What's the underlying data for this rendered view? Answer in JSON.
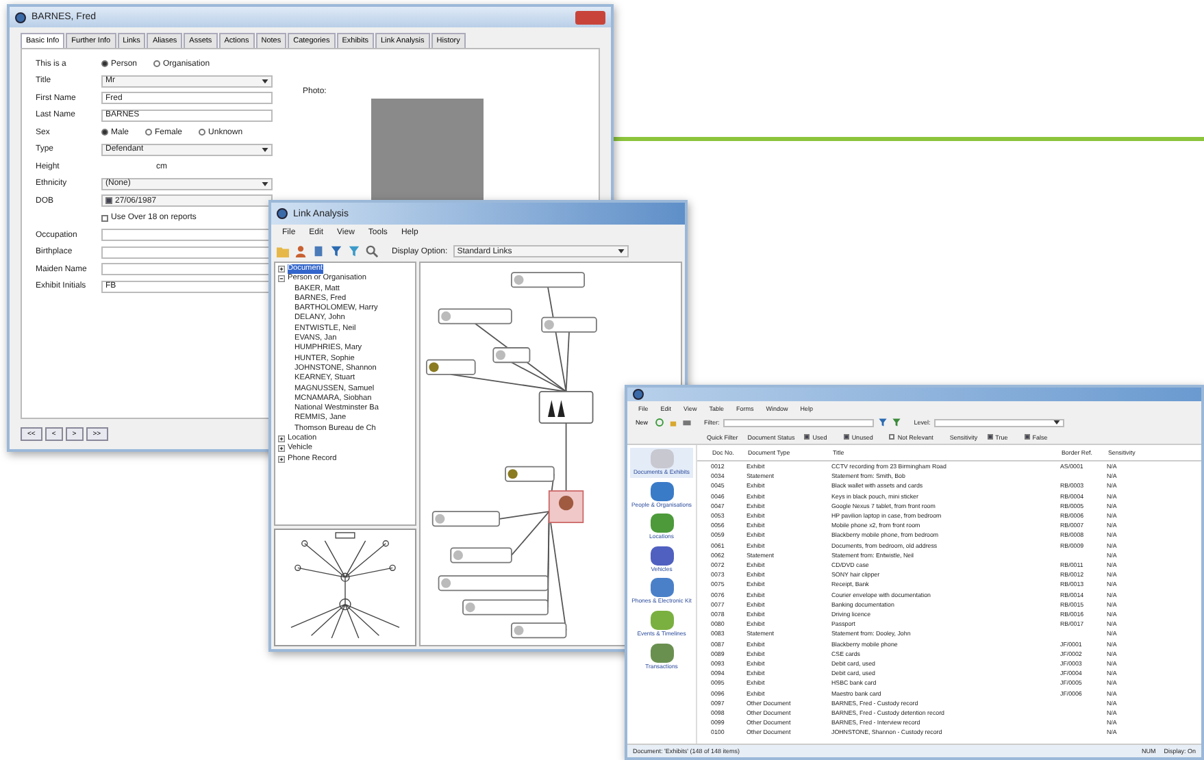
{
  "person_window": {
    "title": "BARNES, Fred",
    "tabs": [
      {
        "label": "Basic Info",
        "selected": true
      },
      {
        "label": "Further Info",
        "selected": false
      },
      {
        "label": "Links",
        "selected": false
      },
      {
        "label": "Aliases",
        "selected": false
      },
      {
        "label": "Assets",
        "selected": false
      },
      {
        "label": "Actions",
        "selected": false
      },
      {
        "label": "Notes",
        "selected": false
      },
      {
        "label": "Categories",
        "selected": false
      },
      {
        "label": "Exhibits",
        "selected": false
      },
      {
        "label": "Link Analysis",
        "selected": false
      },
      {
        "label": "History",
        "selected": false
      }
    ],
    "photo_label": "Photo:",
    "fields": [
      {
        "kind": "radio",
        "label": "This is a",
        "options": [
          {
            "label": "Person",
            "selected": true
          },
          {
            "label": "Organisation",
            "selected": false
          }
        ]
      },
      {
        "kind": "select",
        "label": "Title",
        "value": "Mr"
      },
      {
        "kind": "text",
        "label": "First Name",
        "value": "Fred"
      },
      {
        "kind": "text",
        "label": "Last Name",
        "value": "BARNES"
      },
      {
        "kind": "radio",
        "label": "Sex",
        "options": [
          {
            "label": "Male",
            "selected": true
          },
          {
            "label": "Female",
            "selected": false
          },
          {
            "label": "Unknown",
            "selected": false
          }
        ]
      },
      {
        "kind": "select",
        "label": "Type",
        "value": "Defendant"
      },
      {
        "kind": "unit",
        "label": "Height",
        "unit": "cm"
      },
      {
        "kind": "select",
        "label": "Ethnicity",
        "value": "(None)"
      },
      {
        "kind": "date",
        "label": "DOB",
        "value": "27/06/1987",
        "checked": true
      },
      {
        "kind": "check",
        "label": "Use Over 18 on reports",
        "checked": false
      },
      {
        "kind": "text",
        "label": "Occupation"
      },
      {
        "kind": "text",
        "label": "Birthplace"
      },
      {
        "kind": "text",
        "label": "Maiden Name"
      },
      {
        "kind": "text",
        "label": "Exhibit Initials",
        "value": "FB"
      }
    ],
    "nav_buttons": [
      "<<",
      "<",
      ">",
      ">>"
    ]
  },
  "link_window": {
    "title": "Link Analysis",
    "menu": [
      "File",
      "Edit",
      "View",
      "Tools",
      "Help"
    ],
    "display_label": "Display Option:",
    "display_value": "Standard Links",
    "tree": [
      {
        "label": "Document",
        "selected": true,
        "expanded": false
      },
      {
        "label": "Person or Organisation",
        "selected": false,
        "expanded": true,
        "children": [
          {
            "label": "BAKER, Matt",
            "selected": false
          },
          {
            "label": "BARNES, Fred",
            "selected": false
          },
          {
            "label": "BARTHOLOMEW, Harry",
            "selected": false
          },
          {
            "label": "DELANY, John",
            "selected": false
          },
          {
            "label": "ENTWISTLE, Neil",
            "selected": false
          },
          {
            "label": "EVANS, Jan",
            "selected": false
          },
          {
            "label": "HUMPHRIES, Mary",
            "selected": false
          },
          {
            "label": "HUNTER, Sophie",
            "selected": false
          },
          {
            "label": "JOHNSTONE, Shannon",
            "selected": false
          },
          {
            "label": "KEARNEY, Stuart",
            "selected": false
          },
          {
            "label": "MAGNUSSEN, Samuel",
            "selected": false
          },
          {
            "label": "MCNAMARA, Siobhan",
            "selected": false
          },
          {
            "label": "National Westminster Ba",
            "selected": false
          },
          {
            "label": "REMMIS, Jane",
            "selected": false
          },
          {
            "label": "Thomson Bureau de Ch",
            "selected": false
          }
        ]
      },
      {
        "label": "Location",
        "selected": false,
        "expanded": false
      },
      {
        "label": "Vehicle",
        "selected": false,
        "expanded": false
      },
      {
        "label": "Phone Record",
        "selected": false,
        "expanded": false
      }
    ]
  },
  "documents_window": {
    "menu": [
      "File",
      "Edit",
      "View",
      "Table",
      "Forms",
      "Window",
      "Help"
    ],
    "new_label": "New",
    "filter_label": "Filter:",
    "level_label": "Level:",
    "quick_filters": [
      {
        "label": "Quick Filter",
        "kind": "label"
      },
      {
        "label": "Document Status",
        "kind": "label"
      },
      {
        "label": "Used",
        "kind": "check",
        "checked": true
      },
      {
        "label": "Unused",
        "kind": "check",
        "checked": true
      },
      {
        "label": "Not Relevant",
        "kind": "check",
        "checked": false
      },
      {
        "label": "Sensitivity",
        "kind": "label"
      },
      {
        "label": "True",
        "kind": "check",
        "checked": true
      },
      {
        "label": "False",
        "kind": "check",
        "checked": true
      }
    ],
    "sidebar": [
      {
        "label": "Documents & Exhibits",
        "selected": true
      },
      {
        "label": "People & Organisations",
        "selected": false
      },
      {
        "label": "Locations",
        "selected": false
      },
      {
        "label": "Vehicles",
        "selected": false
      },
      {
        "label": "Phones & Electronic Kit",
        "selected": false
      },
      {
        "label": "Events & Timelines",
        "selected": false
      },
      {
        "label": "Transactions",
        "selected": false
      }
    ],
    "columns": [
      "Doc No.",
      "Document Type",
      "Title",
      "Border Ref.",
      "Sensitivity"
    ],
    "rows": [
      [
        "0012",
        "Exhibit",
        "CCTV recording from 23 Birmingham Road",
        "AS/0001",
        "N/A"
      ],
      [
        "0034",
        "Statement",
        "Statement from: Smith, Bob",
        "",
        "N/A"
      ],
      [
        "0045",
        "Exhibit",
        "Black wallet with assets and cards",
        "RB/0003",
        "N/A"
      ],
      [
        "0046",
        "Exhibit",
        "Keys in black pouch, mini sticker",
        "RB/0004",
        "N/A"
      ],
      [
        "0047",
        "Exhibit",
        "Google Nexus 7 tablet, from front room",
        "RB/0005",
        "N/A"
      ],
      [
        "0053",
        "Exhibit",
        "HP pavilion laptop in case, from bedroom",
        "RB/0006",
        "N/A"
      ],
      [
        "0056",
        "Exhibit",
        "Mobile phone x2, from front room",
        "RB/0007",
        "N/A"
      ],
      [
        "0059",
        "Exhibit",
        "Blackberry mobile phone, from bedroom",
        "RB/0008",
        "N/A"
      ],
      [
        "0061",
        "Exhibit",
        "Documents, from bedroom, old address",
        "RB/0009",
        "N/A"
      ],
      [
        "0062",
        "Statement",
        "Statement from: Entwistle, Neil",
        "",
        "N/A"
      ],
      [
        "0072",
        "Exhibit",
        "CD/DVD case",
        "RB/0011",
        "N/A"
      ],
      [
        "0073",
        "Exhibit",
        "SONY hair clipper",
        "RB/0012",
        "N/A"
      ],
      [
        "0075",
        "Exhibit",
        "Receipt, Bank",
        "RB/0013",
        "N/A"
      ],
      [
        "0076",
        "Exhibit",
        "Courier envelope with documentation",
        "RB/0014",
        "N/A"
      ],
      [
        "0077",
        "Exhibit",
        "Banking documentation",
        "RB/0015",
        "N/A"
      ],
      [
        "0078",
        "Exhibit",
        "Driving licence",
        "RB/0016",
        "N/A"
      ],
      [
        "0080",
        "Exhibit",
        "Passport",
        "RB/0017",
        "N/A"
      ],
      [
        "0083",
        "Statement",
        "Statement from: Dooley, John",
        "",
        "N/A"
      ],
      [
        "0087",
        "Exhibit",
        "Blackberry mobile phone",
        "JF/0001",
        "N/A"
      ],
      [
        "0089",
        "Exhibit",
        "CSE cards",
        "JF/0002",
        "N/A"
      ],
      [
        "0093",
        "Exhibit",
        "Debit card, used",
        "JF/0003",
        "N/A"
      ],
      [
        "0094",
        "Exhibit",
        "Debit card, used",
        "JF/0004",
        "N/A"
      ],
      [
        "0095",
        "Exhibit",
        "HSBC bank card",
        "JF/0005",
        "N/A"
      ],
      [
        "0096",
        "Exhibit",
        "Maestro bank card",
        "JF/0006",
        "N/A"
      ],
      [
        "0097",
        "Other Document",
        "BARNES, Fred - Custody record",
        "",
        "N/A"
      ],
      [
        "0098",
        "Other Document",
        "BARNES, Fred - Custody detention record",
        "",
        "N/A"
      ],
      [
        "0099",
        "Other Document",
        "BARNES, Fred - Interview record",
        "",
        "N/A"
      ],
      [
        "0100",
        "Other Document",
        "JOHNSTONE, Shannon - Custody record",
        "",
        "N/A"
      ]
    ],
    "status": "Document: 'Exhibits' (148 of 148 items)",
    "status_right": [
      "NUM",
      "Display: On"
    ]
  }
}
